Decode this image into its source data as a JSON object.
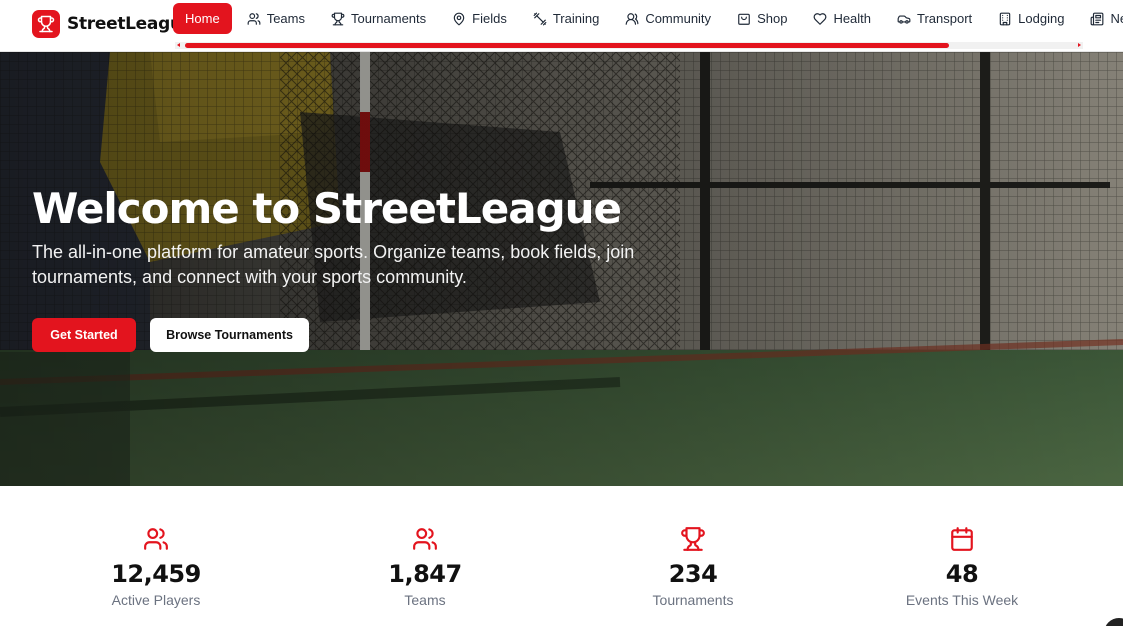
{
  "brand": {
    "name": "StreetLeague",
    "logo_icon": "trophy-icon"
  },
  "nav": {
    "items": [
      {
        "label": "Home",
        "icon": "home-icon",
        "active": true
      },
      {
        "label": "Teams",
        "icon": "users-icon"
      },
      {
        "label": "Tournaments",
        "icon": "trophy-icon"
      },
      {
        "label": "Fields",
        "icon": "map-pin-icon"
      },
      {
        "label": "Training",
        "icon": "dumbbell-icon"
      },
      {
        "label": "Community",
        "icon": "user-group-icon"
      },
      {
        "label": "Shop",
        "icon": "shopping-bag-icon"
      },
      {
        "label": "Health",
        "icon": "heart-icon"
      },
      {
        "label": "Transport",
        "icon": "car-icon"
      },
      {
        "label": "Lodging",
        "icon": "building-icon"
      },
      {
        "label": "New",
        "icon": "newspaper-icon"
      }
    ]
  },
  "hero": {
    "title": "Welcome to StreetLeague",
    "subtitle": "The all-in-one platform for amateur sports. Organize teams, book fields, join tournaments, and connect with your sports community.",
    "primary_button": "Get Started",
    "secondary_button": "Browse Tournaments"
  },
  "stats": [
    {
      "value": "12,459",
      "label": "Active Players",
      "icon": "users-icon"
    },
    {
      "value": "1,847",
      "label": "Teams",
      "icon": "users-icon"
    },
    {
      "value": "234",
      "label": "Tournaments",
      "icon": "trophy-icon"
    },
    {
      "value": "48",
      "label": "Events This Week",
      "icon": "calendar-icon"
    }
  ],
  "colors": {
    "accent": "#e3141e",
    "text": "#111111",
    "muted": "#6b7280"
  }
}
